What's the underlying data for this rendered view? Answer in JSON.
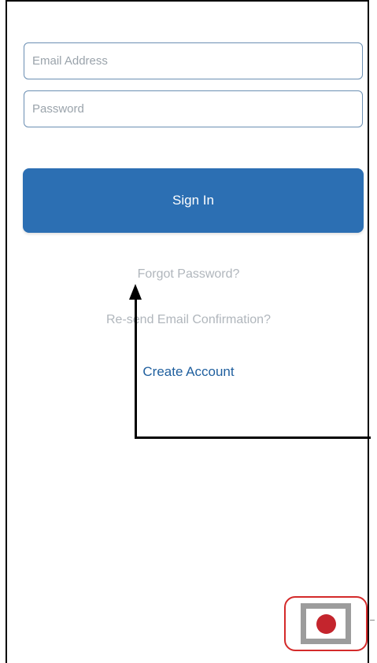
{
  "login": {
    "email_placeholder": "Email Address",
    "password_placeholder": "Password",
    "sign_in_label": "Sign In",
    "forgot_password_label": "Forgot Password?",
    "resend_confirmation_label": "Re-send Email Confirmation?",
    "create_account_label": "Create Account"
  },
  "icons": {
    "annotation_arrow": "arrow-up-icon",
    "record": "record-icon"
  },
  "colors": {
    "primary": "#2c6fb3",
    "field_border": "#6b8fb3",
    "muted_link": "#b0b6bc",
    "link": "#1f5f9e",
    "annotation": "#000000",
    "highlight": "#d42a2a",
    "record_dot": "#c4252d"
  }
}
